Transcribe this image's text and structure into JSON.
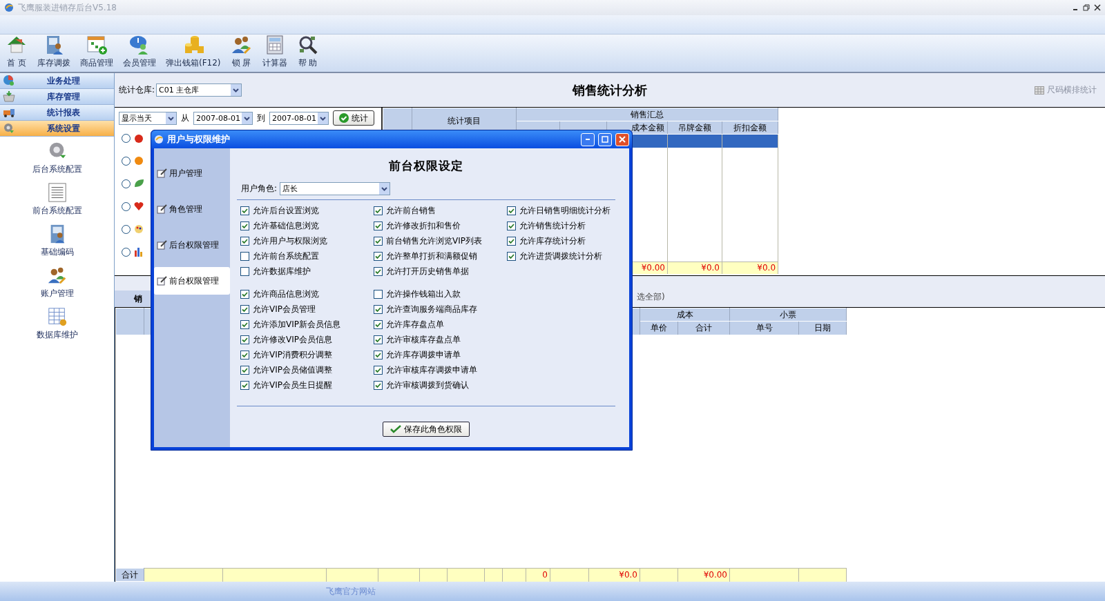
{
  "window": {
    "title": "飞鹰服装进销存后台V5.18"
  },
  "toolbar": [
    {
      "label": "首 页"
    },
    {
      "label": "库存调拨"
    },
    {
      "label": "商品管理"
    },
    {
      "label": "会员管理"
    },
    {
      "label": "弹出钱箱(F12)"
    },
    {
      "label": "锁 屏"
    },
    {
      "label": "计算器"
    },
    {
      "label": "帮 助"
    }
  ],
  "sidebar": {
    "sections": [
      {
        "label": "业务处理",
        "selected": false
      },
      {
        "label": "库存管理",
        "selected": false
      },
      {
        "label": "统计报表",
        "selected": false
      },
      {
        "label": "系统设置",
        "selected": true
      }
    ],
    "items": [
      {
        "label": "后台系统配置"
      },
      {
        "label": "前台系统配置"
      },
      {
        "label": "基础编码"
      },
      {
        "label": "账户管理"
      },
      {
        "label": "数据库维护"
      }
    ]
  },
  "filter": {
    "warehouse_label": "统计仓库:",
    "warehouse": "C01 主仓库",
    "period": "显示当天",
    "from_label": "从",
    "from": "2007-08-01",
    "to_label": "到",
    "to": "2007-08-01",
    "button": "统计"
  },
  "page_title": "销售统计分析",
  "size_layout_button": "尺码横排统计",
  "options": [
    {
      "selected": false
    },
    {
      "selected": false
    },
    {
      "selected": false
    },
    {
      "selected": false
    },
    {
      "selected": false
    },
    {
      "selected": false
    }
  ],
  "summary_grid": {
    "item_column": "统计项目",
    "group": "销售汇总",
    "columns": [
      "成本金额",
      "吊牌金额",
      "折扣金额"
    ],
    "totals": [
      "¥0.00",
      "¥0.0",
      "¥0.0"
    ]
  },
  "detail": {
    "tab": "销",
    "hint": "选全部)",
    "groups": [
      {
        "label": "成本",
        "columns": [
          "单价",
          "合计"
        ]
      },
      {
        "label": "小票",
        "columns": [
          "单号",
          "日期"
        ]
      }
    ],
    "totals_label": "合计",
    "totals": [
      "0",
      "¥0.0",
      "¥0.00"
    ]
  },
  "status_bar": {
    "link": "飞鹰官方网站"
  },
  "dialog": {
    "title": "用户与权限维护",
    "nav": [
      {
        "label": "用户管理",
        "selected": false
      },
      {
        "label": "角色管理",
        "selected": false
      },
      {
        "label": "后台权限管理",
        "selected": false
      },
      {
        "label": "前台权限管理",
        "selected": true
      }
    ],
    "heading": "前台权限设定",
    "role_label": "用户角色:",
    "role": "店长",
    "sections": [
      {
        "columns": [
          [
            {
              "label": "允许后台设置浏览",
              "checked": true
            },
            {
              "label": "允许基础信息浏览",
              "checked": true
            },
            {
              "label": "允许用户与权限浏览",
              "checked": true
            },
            {
              "label": "允许前台系统配置",
              "checked": false
            },
            {
              "label": "允许数据库维护",
              "checked": false
            }
          ],
          [
            {
              "label": "允许前台销售",
              "checked": true
            },
            {
              "label": "允许修改折扣和售价",
              "checked": true
            },
            {
              "label": "前台销售允许浏览VIP列表",
              "checked": true
            },
            {
              "label": "允许整单打折和满额促销",
              "checked": true
            },
            {
              "label": "允许打开历史销售单据",
              "checked": true
            }
          ],
          [
            {
              "label": "允许日销售明细统计分析",
              "checked": true
            },
            {
              "label": "允许销售统计分析",
              "checked": true
            },
            {
              "label": "允许库存统计分析",
              "checked": true
            },
            {
              "label": "允许进货调拨统计分析",
              "checked": true
            }
          ]
        ]
      },
      {
        "columns": [
          [
            {
              "label": "允许商品信息浏览",
              "checked": true
            },
            {
              "label": "允许VIP会员管理",
              "checked": true
            },
            {
              "label": "允许添加VIP新会员信息",
              "checked": true
            },
            {
              "label": "允许修改VIP会员信息",
              "checked": true
            },
            {
              "label": "允许VIP消费积分调整",
              "checked": true
            },
            {
              "label": "允许VIP会员储值调整",
              "checked": true
            },
            {
              "label": "允许VIP会员生日提醒",
              "checked": true
            }
          ],
          [
            {
              "label": "允许操作钱箱出入款",
              "checked": false
            },
            {
              "label": "允许查询服务端商品库存",
              "checked": true
            },
            {
              "label": "允许库存盘点单",
              "checked": true
            },
            {
              "label": "允许审核库存盘点单",
              "checked": true
            },
            {
              "label": "允许库存调拨申请单",
              "checked": true
            },
            {
              "label": "允许审核库存调拨申请单",
              "checked": true
            },
            {
              "label": "允许审核调拨到货确认",
              "checked": true
            }
          ]
        ]
      }
    ],
    "save_button": "保存此角色权限"
  }
}
